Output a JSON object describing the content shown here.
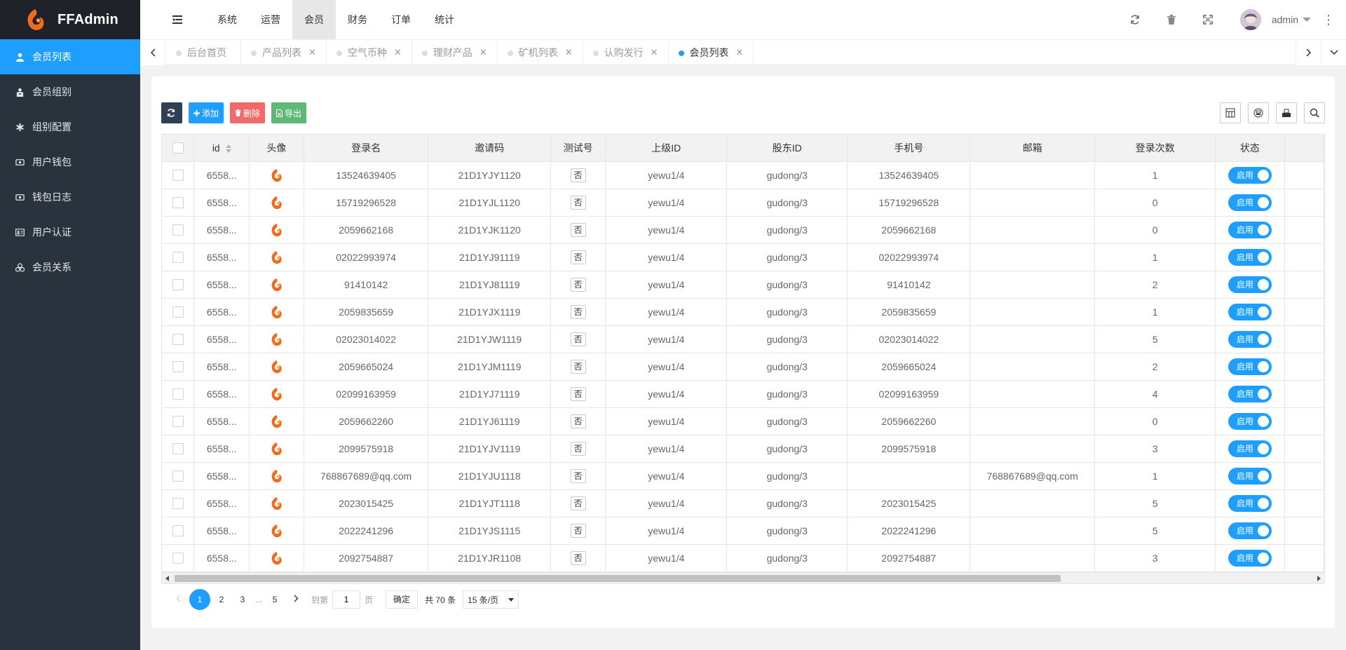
{
  "app": {
    "title": "FFAdmin"
  },
  "sidebar": {
    "items": [
      {
        "label": "会员列表",
        "icon": "user-icon",
        "active": true
      },
      {
        "label": "会员组别",
        "icon": "user-group-icon",
        "active": false
      },
      {
        "label": "组别配置",
        "icon": "asterisk-icon",
        "active": false
      },
      {
        "label": "用户钱包",
        "icon": "wallet-icon",
        "active": false
      },
      {
        "label": "钱包日志",
        "icon": "wallet-log-icon",
        "active": false
      },
      {
        "label": "用户认证",
        "icon": "id-card-icon",
        "active": false
      },
      {
        "label": "会员关系",
        "icon": "relationship-icon",
        "active": false
      }
    ]
  },
  "topnav": {
    "items": [
      {
        "label": "系统",
        "active": false
      },
      {
        "label": "运营",
        "active": false
      },
      {
        "label": "会员",
        "active": true
      },
      {
        "label": "财务",
        "active": false
      },
      {
        "label": "订单",
        "active": false
      },
      {
        "label": "统计",
        "active": false
      }
    ]
  },
  "header": {
    "username": "admin"
  },
  "tabs": [
    {
      "label": "后台首页",
      "closable": false,
      "active": false
    },
    {
      "label": "产品列表",
      "closable": true,
      "active": false
    },
    {
      "label": "空气币种",
      "closable": true,
      "active": false
    },
    {
      "label": "理财产品",
      "closable": true,
      "active": false
    },
    {
      "label": "矿机列表",
      "closable": true,
      "active": false
    },
    {
      "label": "认购发行",
      "closable": true,
      "active": false
    },
    {
      "label": "会员列表",
      "closable": true,
      "active": true
    }
  ],
  "toolbar": {
    "add_label": "添加",
    "delete_label": "删除",
    "export_label": "导出"
  },
  "table": {
    "columns": [
      "id",
      "头像",
      "登录名",
      "邀请码",
      "测试号",
      "上级ID",
      "股东ID",
      "手机号",
      "邮箱",
      "登录次数",
      "状态"
    ],
    "test_label": "否",
    "status_label": "启用",
    "rows": [
      {
        "id": "6558...",
        "login": "13524639405",
        "invite": "21D1YJY1120",
        "parent": "yewu1/4",
        "shareholder": "gudong/3",
        "phone": "13524639405",
        "email": "",
        "logins": "1"
      },
      {
        "id": "6558...",
        "login": "15719296528",
        "invite": "21D1YJL1120",
        "parent": "yewu1/4",
        "shareholder": "gudong/3",
        "phone": "15719296528",
        "email": "",
        "logins": "0"
      },
      {
        "id": "6558...",
        "login": "2059662168",
        "invite": "21D1YJK1120",
        "parent": "yewu1/4",
        "shareholder": "gudong/3",
        "phone": "2059662168",
        "email": "",
        "logins": "0"
      },
      {
        "id": "6558...",
        "login": "02022993974",
        "invite": "21D1YJ91119",
        "parent": "yewu1/4",
        "shareholder": "gudong/3",
        "phone": "02022993974",
        "email": "",
        "logins": "1"
      },
      {
        "id": "6558...",
        "login": "91410142",
        "invite": "21D1YJ81119",
        "parent": "yewu1/4",
        "shareholder": "gudong/3",
        "phone": "91410142",
        "email": "",
        "logins": "2"
      },
      {
        "id": "6558...",
        "login": "2059835659",
        "invite": "21D1YJX1119",
        "parent": "yewu1/4",
        "shareholder": "gudong/3",
        "phone": "2059835659",
        "email": "",
        "logins": "1"
      },
      {
        "id": "6558...",
        "login": "02023014022",
        "invite": "21D1YJW1119",
        "parent": "yewu1/4",
        "shareholder": "gudong/3",
        "phone": "02023014022",
        "email": "",
        "logins": "5"
      },
      {
        "id": "6558...",
        "login": "2059665024",
        "invite": "21D1YJM1119",
        "parent": "yewu1/4",
        "shareholder": "gudong/3",
        "phone": "2059665024",
        "email": "",
        "logins": "2"
      },
      {
        "id": "6558...",
        "login": "02099163959",
        "invite": "21D1YJ71119",
        "parent": "yewu1/4",
        "shareholder": "gudong/3",
        "phone": "02099163959",
        "email": "",
        "logins": "4"
      },
      {
        "id": "6558...",
        "login": "2059662260",
        "invite": "21D1YJ61119",
        "parent": "yewu1/4",
        "shareholder": "gudong/3",
        "phone": "2059662260",
        "email": "",
        "logins": "0"
      },
      {
        "id": "6558...",
        "login": "2099575918",
        "invite": "21D1YJV1119",
        "parent": "yewu1/4",
        "shareholder": "gudong/3",
        "phone": "2099575918",
        "email": "",
        "logins": "3"
      },
      {
        "id": "6558...",
        "login": "768867689@qq.com",
        "invite": "21D1YJU1118",
        "parent": "yewu1/4",
        "shareholder": "gudong/3",
        "phone": "",
        "email": "768867689@qq.com",
        "logins": "1"
      },
      {
        "id": "6558...",
        "login": "2023015425",
        "invite": "21D1YJT1118",
        "parent": "yewu1/4",
        "shareholder": "gudong/3",
        "phone": "2023015425",
        "email": "",
        "logins": "5"
      },
      {
        "id": "6558...",
        "login": "2022241296",
        "invite": "21D1YJS1115",
        "parent": "yewu1/4",
        "shareholder": "gudong/3",
        "phone": "2022241296",
        "email": "",
        "logins": "5"
      },
      {
        "id": "6558...",
        "login": "2092754887",
        "invite": "21D1YJR1108",
        "parent": "yewu1/4",
        "shareholder": "gudong/3",
        "phone": "2092754887",
        "email": "",
        "logins": "3"
      }
    ]
  },
  "pagination": {
    "pages": [
      "1",
      "2",
      "3",
      "...",
      "5"
    ],
    "current": "1",
    "goto_label": "到第",
    "goto_value": "1",
    "page_label": "页",
    "confirm_label": "确定",
    "total_label": "共 70 条",
    "page_size": "15 条/页"
  },
  "colors": {
    "accent": "#1e9fff",
    "sidebar": "#28333e",
    "logo_bg": "#20222a",
    "danger": "#f16a6a",
    "success": "#5fb878",
    "dark_btn": "#2f4056"
  }
}
